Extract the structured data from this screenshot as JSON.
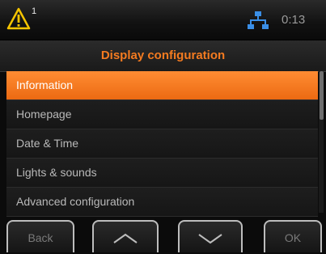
{
  "status": {
    "warning_count": "1",
    "time": "0:13",
    "icons": [
      "warning-triangle-icon",
      "network-icon"
    ]
  },
  "header": {
    "title": "Display configuration"
  },
  "menu": {
    "selected_index": 0,
    "items": [
      {
        "label": "Information"
      },
      {
        "label": "Homepage"
      },
      {
        "label": "Date & Time"
      },
      {
        "label": "Lights & sounds"
      },
      {
        "label": "Advanced configuration"
      }
    ]
  },
  "softkeys": {
    "back_label": "Back",
    "up_icon": "chevron-up-icon",
    "down_icon": "chevron-down-icon",
    "ok_label": "OK"
  },
  "colors": {
    "accent": "#f47b20",
    "selected_bg": "#ec6a12",
    "warning": "#f5c400",
    "network": "#3a8ee6"
  }
}
